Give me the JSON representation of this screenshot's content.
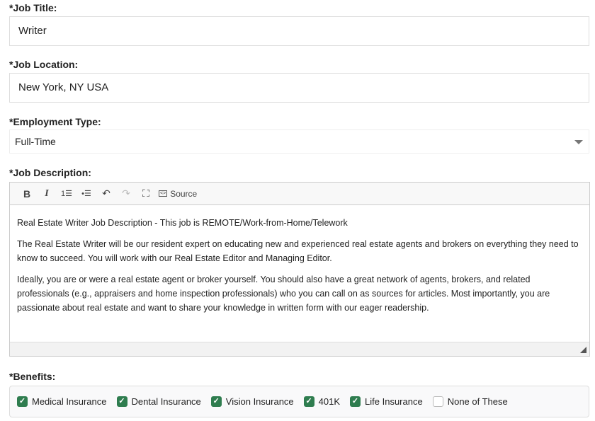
{
  "job_title": {
    "label": "*Job Title:",
    "value": "Writer"
  },
  "job_location": {
    "label": "*Job Location:",
    "value": "New York, NY USA"
  },
  "employment_type": {
    "label": "*Employment Type:",
    "value": "Full-Time"
  },
  "job_description": {
    "label": "*Job Description:",
    "toolbar": {
      "bold": "B",
      "italic": "I",
      "source": "Source"
    },
    "paragraphs": [
      "Real Estate Writer Job Description - This job is REMOTE/Work-from-Home/Telework",
      "The Real Estate Writer will be our resident expert on educating new and experienced real estate agents and brokers on everything they need to know to succeed. You will work with our Real Estate Editor and Managing Editor.",
      "Ideally, you are or were a real estate agent or broker yourself. You should also have a great network of agents, brokers, and related professionals (e.g., appraisers and home inspection professionals) who you can call on as sources for articles. Most importantly, you are passionate about real estate and want to share your knowledge in written form with our eager readership."
    ]
  },
  "benefits": {
    "label": "*Benefits:",
    "accent": "#2f7d4f",
    "options": [
      {
        "label": "Medical Insurance",
        "checked": true
      },
      {
        "label": "Dental Insurance",
        "checked": true
      },
      {
        "label": "Vision Insurance",
        "checked": true
      },
      {
        "label": "401K",
        "checked": true
      },
      {
        "label": "Life Insurance",
        "checked": true
      },
      {
        "label": "None of These",
        "checked": false
      }
    ]
  }
}
